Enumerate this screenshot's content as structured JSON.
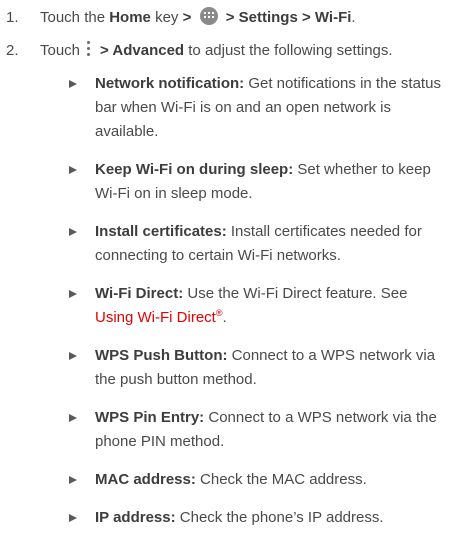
{
  "steps": [
    {
      "number": "1.",
      "prefix": "Touch the ",
      "home": "Home",
      "key_text": " key",
      "sep": ">",
      "path": "> Settings > Wi-Fi",
      "end": "."
    },
    {
      "number": "2.",
      "prefix": "Touch",
      "advanced": "> Advanced",
      "suffix": " to adjust the following settings."
    }
  ],
  "options": [
    {
      "term": "Network notification:",
      "desc": " Get notifications in the status bar when Wi-Fi is on and an open network is available."
    },
    {
      "term": "Keep Wi-Fi on during sleep:",
      "desc": " Set whether to keep Wi-Fi on in sleep mode."
    },
    {
      "term": "Install certificates:",
      "desc": " Install certificates needed for connecting to certain Wi-Fi networks."
    },
    {
      "term": "Wi-Fi Direct:",
      "desc": " Use the Wi-Fi Direct feature. See ",
      "link": "Using Wi-Fi Direct",
      "reg": "®",
      "after": "."
    },
    {
      "term": "WPS Push Button:",
      "desc": " Connect to a WPS network via the push button method."
    },
    {
      "term": "WPS Pin Entry:",
      "desc": " Connect to a WPS network via the phone PIN method."
    },
    {
      "term": "MAC address:",
      "desc": " Check the MAC address."
    },
    {
      "term": "IP address:",
      "desc": " Check the phone’s IP address."
    }
  ],
  "colors": {
    "link": "#e60000",
    "text": "#4a4a4a"
  },
  "icons": {
    "apps": "apps-grid-icon",
    "menu": "overflow-menu-icon",
    "bullet": "triangle-bullet-icon"
  }
}
